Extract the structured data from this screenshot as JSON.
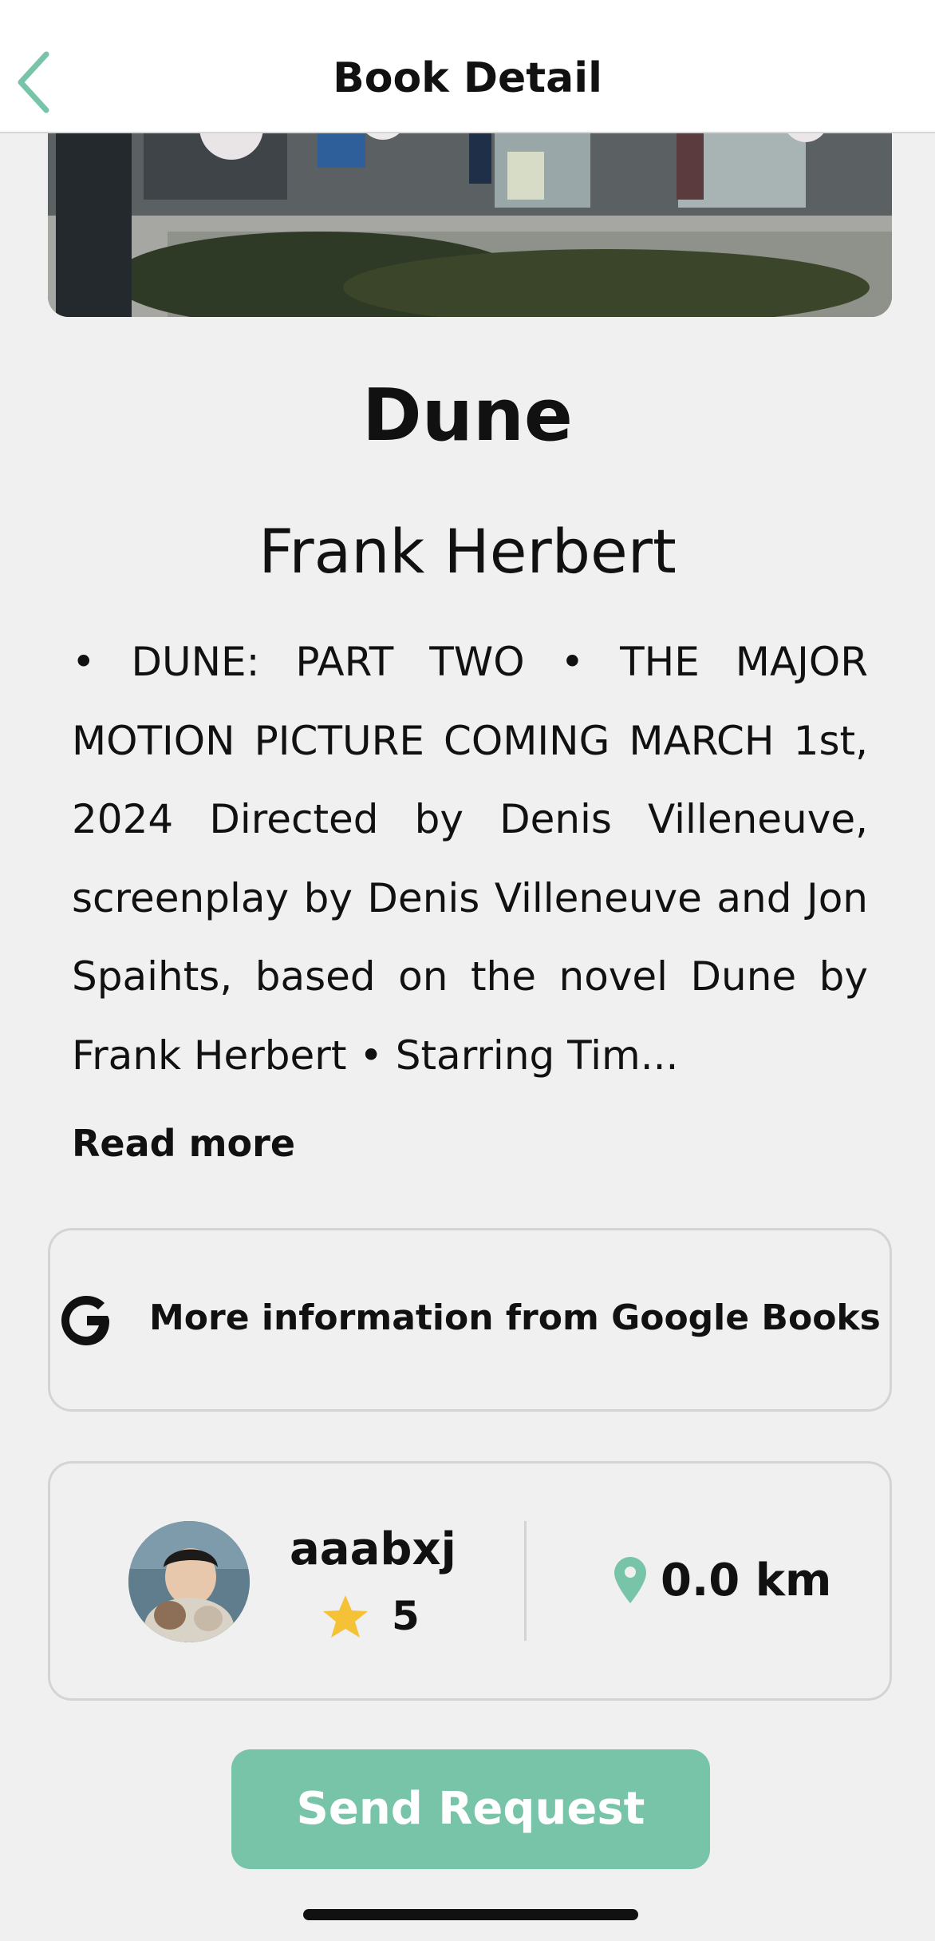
{
  "header": {
    "title": "Book Detail",
    "back_icon": "chevron-left-icon"
  },
  "book": {
    "title": "Dune",
    "author": "Frank Herbert",
    "description": "• DUNE: PART TWO • THE MAJOR MOTION PICTURE COMING MARCH 1st, 2024 Directed by Denis Villeneuve, screenplay by Denis Villeneuve and Jon Spaihts, based on the novel Dune by Frank Herbert • Starring Tim...",
    "read_more_label": "Read more"
  },
  "google_books": {
    "icon": "google-icon",
    "label": "More information from Google Books"
  },
  "owner": {
    "username": "aaabxj",
    "rating": "5",
    "distance": "0.0 km"
  },
  "actions": {
    "send_request_label": "Send Request"
  },
  "colors": {
    "accent": "#77c4a8",
    "star": "#f5c237",
    "background": "#f0f0f0"
  }
}
